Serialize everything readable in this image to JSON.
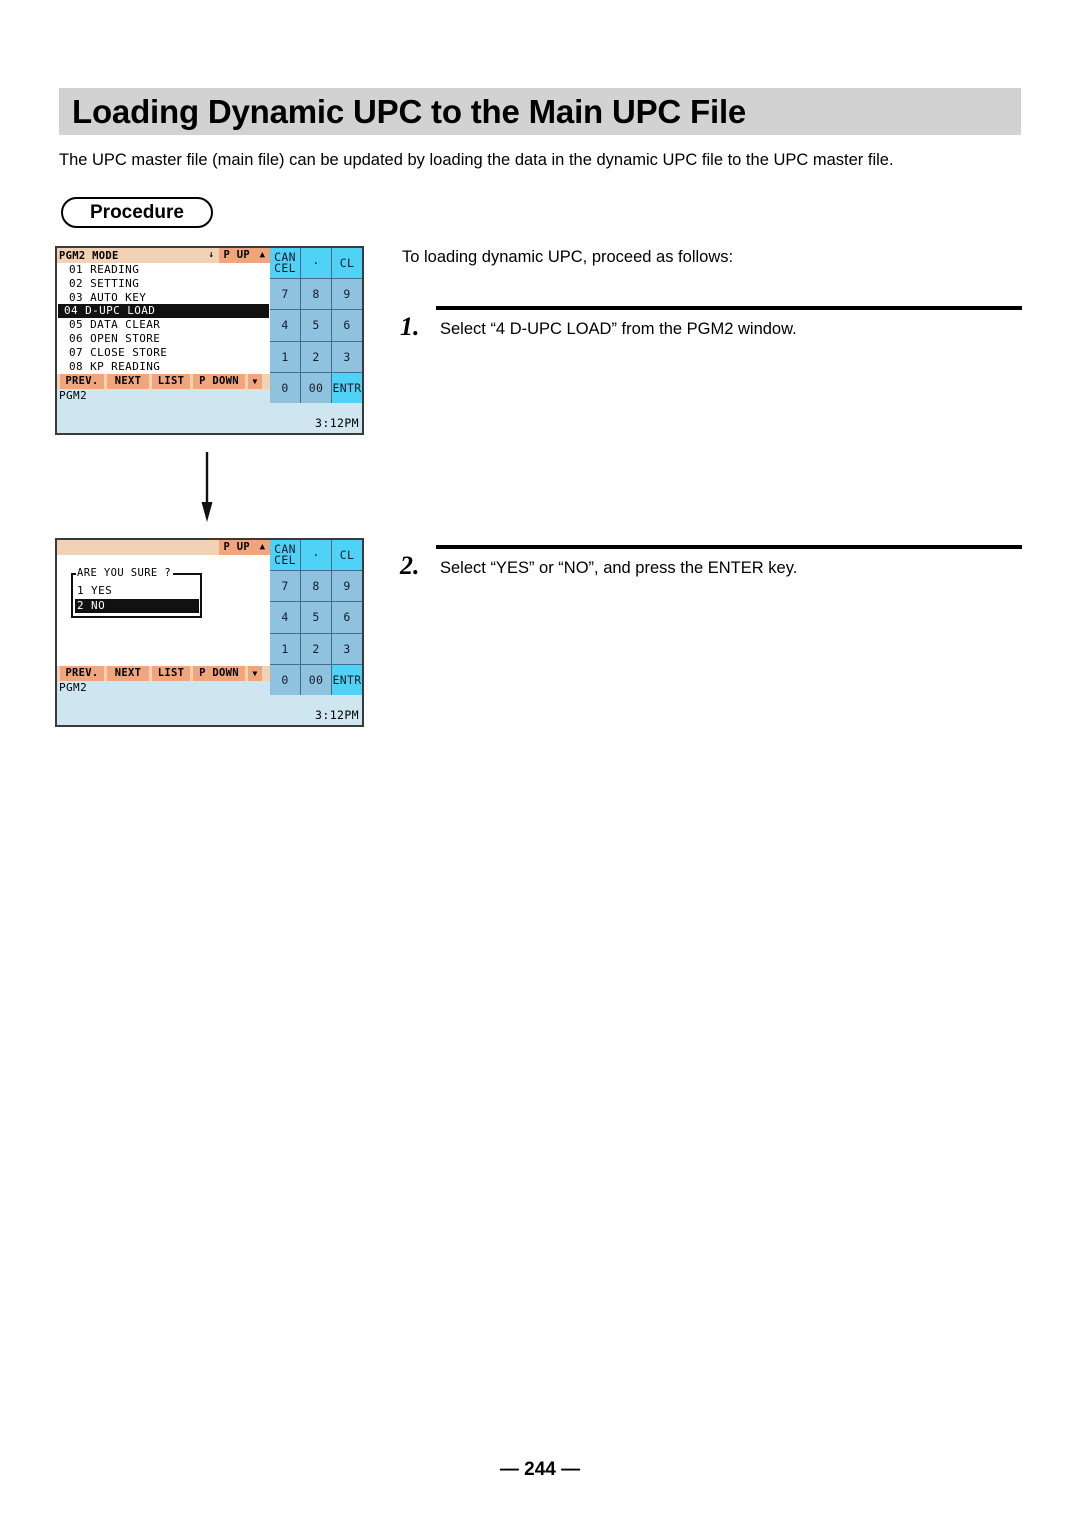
{
  "page": {
    "title": "Loading Dynamic UPC to the Main UPC File",
    "intro": "The UPC master file (main file) can be updated by loading the data in the dynamic UPC file to the UPC master file.",
    "section_label": "Procedure",
    "lead_text": "To loading dynamic UPC, proceed as follows:",
    "footer": "— 244 —"
  },
  "steps": [
    {
      "number": "1.",
      "text": "Select “4 D-UPC LOAD” from the PGM2 window."
    },
    {
      "number": "2.",
      "text": "Select “YES” or “NO”, and press the ENTER key."
    }
  ],
  "screen1": {
    "topbar": {
      "title": "PGM2 MODE",
      "down_arrow": "↓",
      "page_up_label": "P UP",
      "up_triangle": "▲"
    },
    "menu": [
      {
        "label": "01 READING",
        "selected": false
      },
      {
        "label": "02 SETTING",
        "selected": false
      },
      {
        "label": "03 AUTO KEY",
        "selected": false
      },
      {
        "label": "04 D-UPC LOAD",
        "selected": true
      },
      {
        "label": "05 DATA CLEAR",
        "selected": false
      },
      {
        "label": "06 OPEN STORE",
        "selected": false
      },
      {
        "label": "07 CLOSE STORE",
        "selected": false
      },
      {
        "label": "08 KP READING",
        "selected": false
      }
    ],
    "softkeys": {
      "prev": "PREV.",
      "next": "NEXT",
      "list": "LIST",
      "page_down": "P DOWN",
      "down_triangle": "▼"
    },
    "status": {
      "mode": "PGM2",
      "time": "3:12PM"
    }
  },
  "screen2": {
    "topbar": {
      "title": "",
      "page_up_label": "P UP",
      "up_triangle": "▲"
    },
    "dialog": {
      "title": "ARE YOU SURE ?",
      "option_yes": "1 YES",
      "option_no": "2 NO"
    },
    "softkeys": {
      "prev": "PREV.",
      "next": "NEXT",
      "list": "LIST",
      "page_down": "P DOWN",
      "down_triangle": "▼"
    },
    "status": {
      "mode": "PGM2",
      "time": "3:12PM"
    }
  },
  "keypad": {
    "cancel_line1": "CAN",
    "cancel_line2": "CEL",
    "dot": "·",
    "clear": "CL",
    "k7": "7",
    "k8": "8",
    "k9": "9",
    "k4": "4",
    "k5": "5",
    "k6": "6",
    "k1": "1",
    "k2": "2",
    "k3": "3",
    "k0": "0",
    "k00": "00",
    "enter": "ENTR"
  },
  "colors": {
    "banner_gray": "#d2d2d2",
    "toolbar_peach": "#f2d2b4",
    "softkey_orange": "#f0a57c",
    "status_blue": "#cfe5ef",
    "key_cyan": "#4fd2f5",
    "key_blue": "#8fc2de",
    "selected_black": "#111111"
  }
}
